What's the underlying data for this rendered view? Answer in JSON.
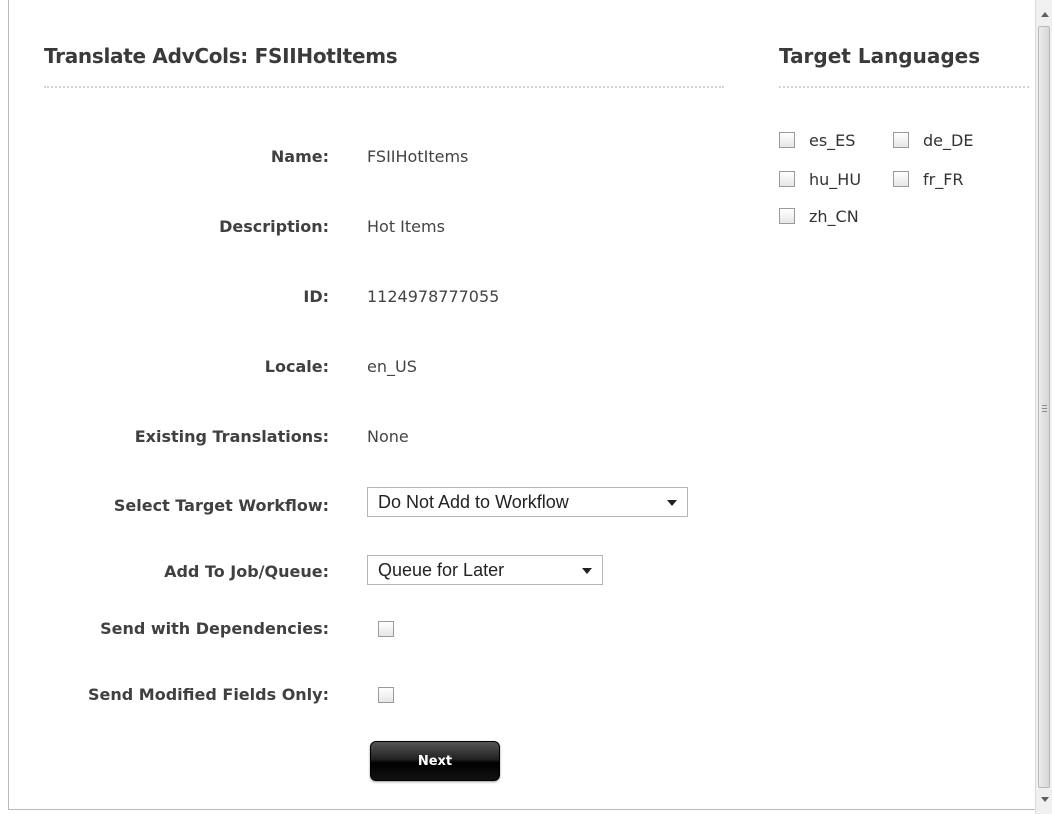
{
  "header": {
    "title": "Translate AdvCols: FSIIHotItems",
    "side_title": "Target Languages"
  },
  "form": {
    "name_label": "Name:",
    "name_value": "FSIIHotItems",
    "description_label": "Description:",
    "description_value": "Hot Items",
    "id_label": "ID:",
    "id_value": "1124978777055",
    "locale_label": "Locale:",
    "locale_value": "en_US",
    "existing_label": "Existing Translations:",
    "existing_value": "None",
    "workflow_label": "Select Target Workflow:",
    "workflow_selected": "Do Not Add to Workflow",
    "job_label": "Add To Job/Queue:",
    "job_selected": "Queue for Later",
    "dependencies_label": "Send with Dependencies:",
    "dependencies_checked": false,
    "modified_label": "Send Modified Fields Only:",
    "modified_checked": false,
    "next_label": "Next"
  },
  "languages": [
    {
      "code": "es_ES",
      "checked": false
    },
    {
      "code": "de_DE",
      "checked": false
    },
    {
      "code": "hu_HU",
      "checked": false
    },
    {
      "code": "fr_FR",
      "checked": false
    },
    {
      "code": "zh_CN",
      "checked": false
    }
  ],
  "icons": {
    "scroll_up": "arrow-up-icon",
    "scroll_down": "arrow-down-icon",
    "dropdown": "chevron-down-icon"
  }
}
